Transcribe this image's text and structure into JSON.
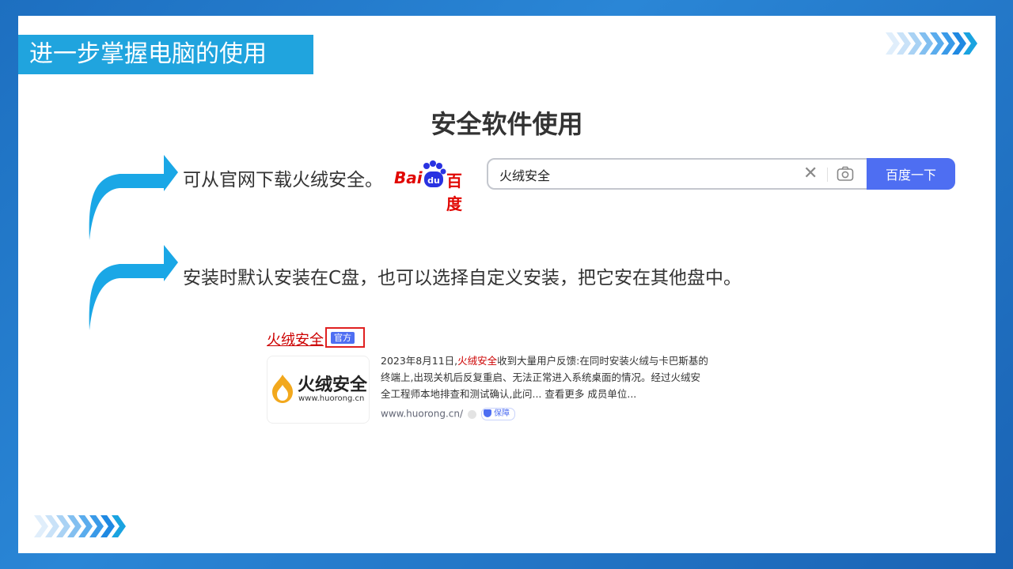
{
  "slide": {
    "section_title": "进一步掌握电脑的使用",
    "heading": "安全软件使用",
    "bullets": [
      {
        "text": "可从官网下载火绒安全。"
      },
      {
        "text": "安装时默认安装在C盘，也可以选择自定义安装，把它安在其他盘中。"
      }
    ]
  },
  "baidu": {
    "logo_text_left": "Bai",
    "logo_text_paw": "du",
    "logo_text_right": "百度",
    "search_value": "火绒安全",
    "search_button": "百度一下",
    "clear_icon": "close-icon",
    "camera_icon": "camera-icon"
  },
  "result": {
    "title": "火绒安全",
    "badge": "官方",
    "thumb_brand": "火绒安全",
    "thumb_url": "www.huorong.cn",
    "snippet_date": "2023年8月11日,",
    "snippet_highlight": "火绒安全",
    "snippet_rest": "收到大量用户反馈:在同时安装火绒与卡巴斯基的终端上,出现关机后反复重启、无法正常进入系统桌面的情况。经过火绒安全工程师本地排查和测试确认,此问... 查看更多 成员单位...",
    "site_url": "www.huorong.cn/",
    "guarantee": "保障"
  },
  "colors": {
    "accent": "#20a4de",
    "baidu_red": "#e10601",
    "baidu_blue": "#4e6ef2"
  }
}
